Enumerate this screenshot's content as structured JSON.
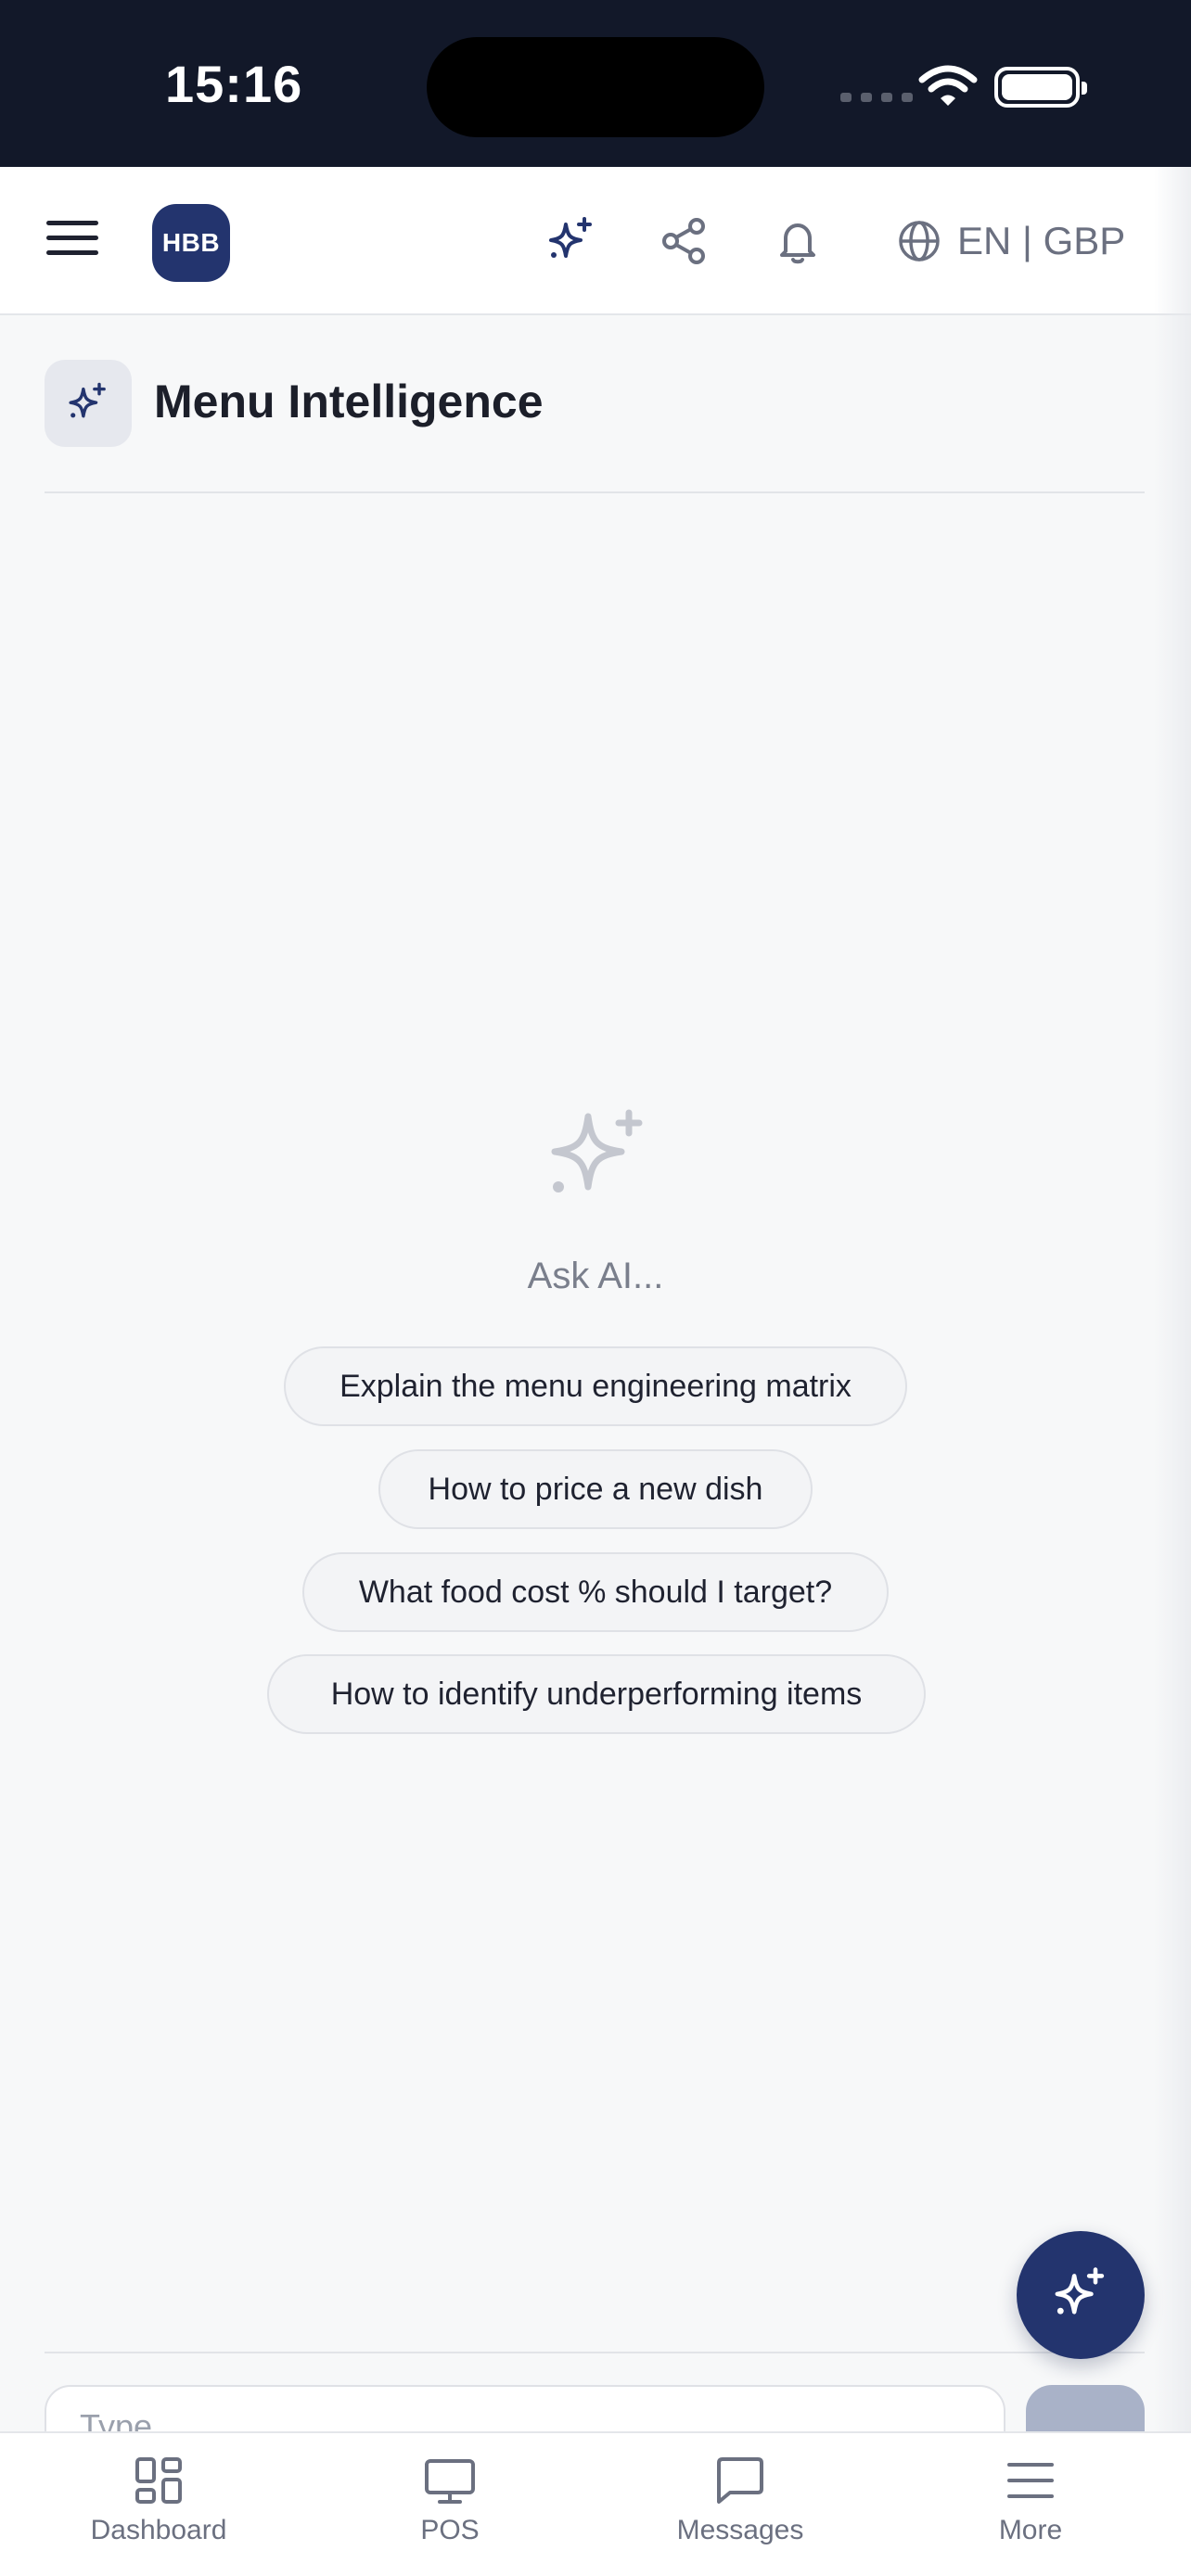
{
  "status_bar": {
    "time": "15:16"
  },
  "header": {
    "avatar_text": "HBB",
    "lang_currency": "EN | GBP"
  },
  "page": {
    "title": "Menu Intelligence"
  },
  "empty_state": {
    "prompt": "Ask AI...",
    "suggestions": [
      "Explain the menu engineering matrix",
      "How to price a new dish",
      "What food cost % should I target?",
      "How to identify underperforming items"
    ]
  },
  "chat": {
    "input_placeholder": "Type..."
  },
  "bottom_nav": {
    "items": [
      {
        "label": "Dashboard",
        "icon": "dashboard-icon"
      },
      {
        "label": "POS",
        "icon": "monitor-icon"
      },
      {
        "label": "Messages",
        "icon": "chat-icon"
      },
      {
        "label": "More",
        "icon": "menu-icon"
      }
    ]
  },
  "colors": {
    "brand": "#23346e",
    "status_bar": "#121829",
    "background": "#f7f8f9"
  }
}
